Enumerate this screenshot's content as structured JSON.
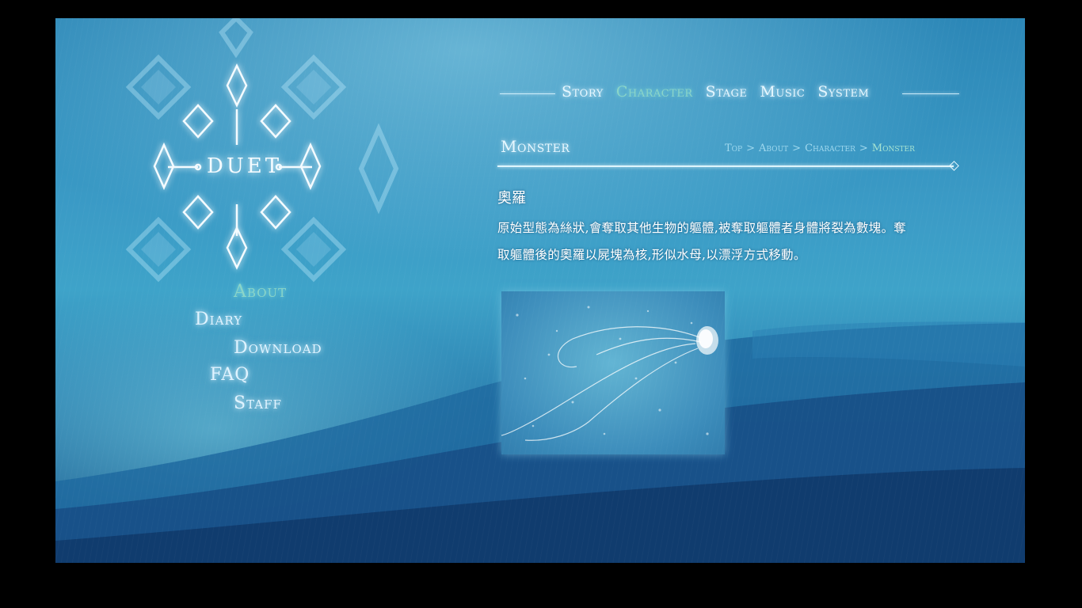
{
  "logo": {
    "text": "DUET"
  },
  "side_menu": [
    {
      "label": "About",
      "active": true
    },
    {
      "label": "Diary",
      "active": false
    },
    {
      "label": "Download",
      "active": false
    },
    {
      "label": "FAQ",
      "active": false
    },
    {
      "label": "Staff",
      "active": false
    }
  ],
  "top_nav": [
    {
      "label": "Story",
      "active": false
    },
    {
      "label": "Character",
      "active": true
    },
    {
      "label": "Stage",
      "active": false
    },
    {
      "label": "Music",
      "active": false
    },
    {
      "label": "System",
      "active": false
    }
  ],
  "section": {
    "title": "Monster",
    "breadcrumb": [
      "Top",
      "About",
      "Character",
      "Monster"
    ],
    "breadcrumb_separator": ">"
  },
  "character": {
    "name": "奧羅",
    "description_line1": "原始型態為絲狀,會奪取其他生物的軀體,被奪取軀體者身體將裂為數塊。奪",
    "description_line2": "取軀體後的奧羅以屍塊為核,形似水母,以漂浮方式移動。"
  },
  "artwork": {
    "icon": "jellyfish-illustration"
  },
  "colors": {
    "frame": "#000000",
    "accent_active": "#8ad5c8",
    "text_glow": "#e6f7ff",
    "sky_mid": "#3ea3c9",
    "hill_dark": "#175487"
  }
}
